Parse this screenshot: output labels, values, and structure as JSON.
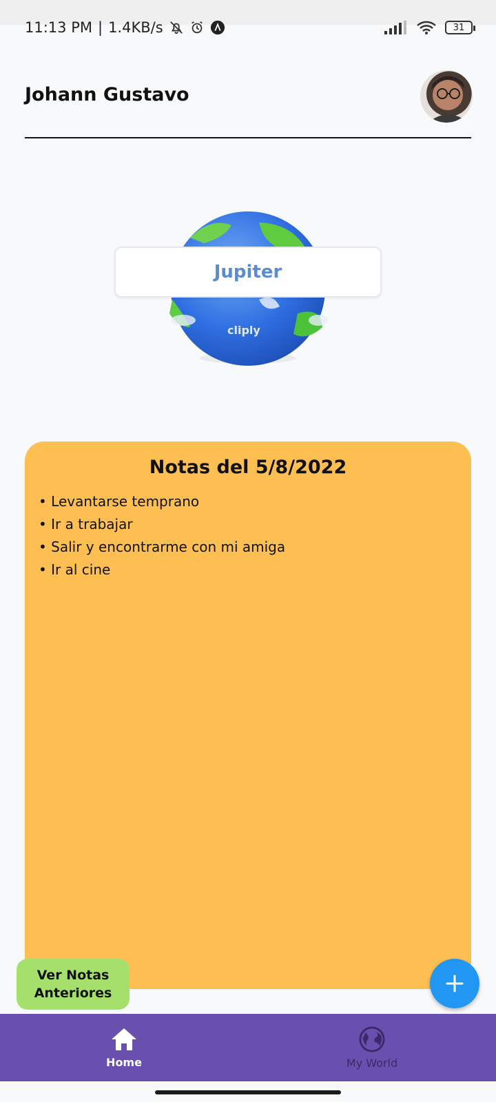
{
  "status_bar": {
    "time": "11:13 PM",
    "speed": "1.4KB/s",
    "battery": "31",
    "icons": [
      "muted-bell-icon",
      "alarm-icon",
      "app-icon",
      "signal-icon",
      "wifi-icon",
      "battery-icon"
    ]
  },
  "header": {
    "user_name": "Johann Gustavo"
  },
  "planet": {
    "name": "Jupiter",
    "watermark": "cliply"
  },
  "notes": {
    "title": "Notas del 5/8/2022",
    "items": [
      "Levantarse temprano",
      "Ir a trabajar",
      "Salir y encontrarme con mi amiga",
      "Ir al cine"
    ]
  },
  "actions": {
    "previous_notes": "Ver Notas Anteriores",
    "add_icon": "plus-icon"
  },
  "bottom_nav": {
    "items": [
      {
        "label": "Home",
        "icon": "home-icon",
        "active": true
      },
      {
        "label": "My World",
        "icon": "globe-icon",
        "active": false
      }
    ]
  },
  "colors": {
    "notes_bg": "#fdbf52",
    "nav_bg": "#6a50ae",
    "fab": "#2196f3",
    "button_green": "#a6e06c",
    "planet_text": "#5b8bd1"
  }
}
